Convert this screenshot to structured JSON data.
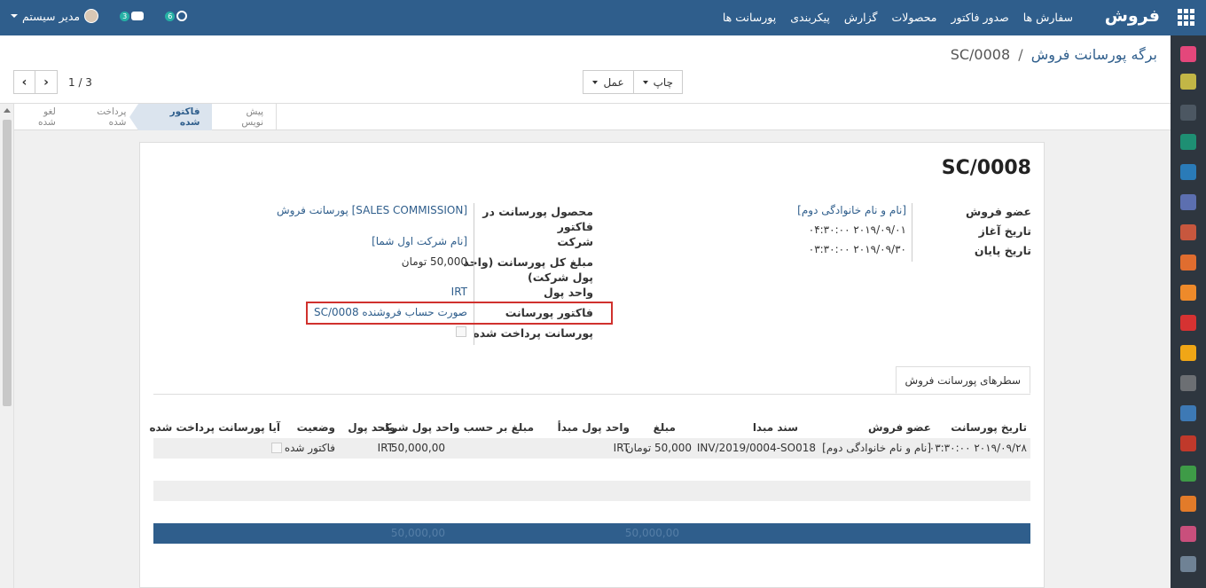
{
  "topbar": {
    "brand": "فروش",
    "menu": [
      "سفارش ها",
      "صدور فاکتور",
      "محصولات",
      "گزارش",
      "پیکربندی",
      "پورسانت ها"
    ],
    "user_name": "مدیر سیستم",
    "chat_count": "3",
    "activity_count": "6"
  },
  "breadcrumb": {
    "parent": "برگه پورسانت فروش",
    "separator": "/",
    "current": "SC/0008"
  },
  "actions": {
    "print_label": "چاپ",
    "action_label": "عمل"
  },
  "pager": {
    "counter": "1 / 3"
  },
  "stages": [
    {
      "label": "پیش نویس",
      "active": false
    },
    {
      "label": "فاکتور شده",
      "active": true
    },
    {
      "label": "پرداخت شده",
      "active": false
    },
    {
      "label": "لغو شده",
      "active": false
    }
  ],
  "sheet": {
    "title": "SC/0008",
    "left_group": {
      "sales_member_label": "عضو فروش",
      "sales_member_value": "[نام و نام خانوادگی دوم]",
      "start_date_label": "تاریخ آغاز",
      "start_date_value": "۲۰۱۹/۰۹/۰۱ ۰۴:۳۰:۰۰",
      "end_date_label": "تاریخ پایان",
      "end_date_value": "۲۰۱۹/۰۹/۳۰ ۰۳:۳۰:۰۰"
    },
    "right_group": {
      "product_label": "محصول پورسانت در فاکتور",
      "product_value": "[SALES COMMISSION] پورسانت فروش",
      "company_label": "شرکت",
      "company_value": "[نام شرکت اول شما]",
      "total_label": "مبلغ کل پورسانت (واحد پول شرکت)",
      "total_value": "50,000 تومان",
      "currency_label": "واحد پول",
      "currency_value": "IRT",
      "invoice_label": "فاکتور پورسانت",
      "invoice_value": "صورت حساب فروشنده SC/0008",
      "paid_label": "پورسانت پرداخت شده"
    },
    "tab_label": "سطرهای پورسانت فروش",
    "table": {
      "headers": [
        "تاریخ پورسانت",
        "عضو فروش",
        "سند مبدا",
        "مبلغ",
        "واحد پول مبدأ",
        "مبلغ بر حسب واحد پول شرکت",
        "واحد پول",
        "وضعیت",
        "آیا پورسانت پرداخت شده"
      ],
      "row": {
        "date": "۲۰۱۹/۰۹/۲۸ ۰۳:۳۰:۰۰",
        "member": "[نام و نام خانوادگی دوم]",
        "source": "INV/2019/0004-SO018",
        "amount": "50,000 تومان",
        "source_currency": "IRT",
        "company_amount": "50,000,00",
        "currency": "IRT",
        "status": "فاکتور شده"
      },
      "footer": {
        "amount_total": "50,000,00",
        "company_total": "50,000,00"
      }
    }
  },
  "colors": {
    "topbar": "#2f5e8c",
    "sidebar": "#2e363f",
    "highlight": "#d0312d"
  }
}
